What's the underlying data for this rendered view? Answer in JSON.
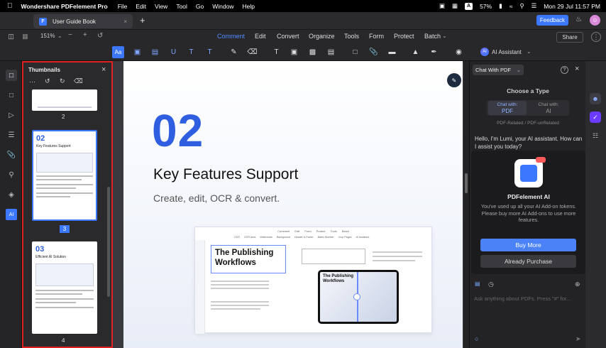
{
  "menubar": {
    "apple": "",
    "app": "Wondershare PDFelement Pro",
    "items": [
      "File",
      "Edit",
      "View",
      "Tool",
      "Go",
      "Window",
      "Help"
    ],
    "battery": "57%",
    "input_badge": "A",
    "datetime": "Mon 29 Jul  11:57 PM"
  },
  "tabbar": {
    "tab_title": "User Guide Book",
    "add_tab": "+",
    "feedback": "Feedback"
  },
  "toolbar": {
    "zoom": "151%",
    "menus": [
      "Comment",
      "Edit",
      "Convert",
      "Organize",
      "Tools",
      "Form",
      "Protect",
      "Batch"
    ],
    "active_menu": "Comment",
    "share": "Share",
    "ai_assistant": "AI Assistant"
  },
  "thumbnails": {
    "title": "Thumbnails",
    "pages": [
      "2",
      "3",
      "4"
    ],
    "current_page": "3",
    "page3_number": "02",
    "page3_title": "Key Features Support",
    "page4_number": "03",
    "page4_title": "Efficient AI Solution"
  },
  "document": {
    "number": "02",
    "heading": "Key Features Support",
    "subheading": "Create, edit, OCR & convert.",
    "embed_menus": [
      "Comment",
      "Edit",
      "Form",
      "Protect",
      "Tools",
      "Batch"
    ],
    "embed_tools": [
      "OCR",
      "OCR Area",
      "Watermark",
      "Background",
      "Header & Footer",
      "Bates Number",
      "Crop Pages",
      "AI Assistant"
    ],
    "embed_title": "The Publishing Workflows",
    "embed_tablet_title": "The Publishing Workflows"
  },
  "ai_panel": {
    "mode_select": "Chat With PDF",
    "choose_type": "Choose a Type",
    "chat_pdf_label1": "Chat with:",
    "chat_pdf_label2": "PDF",
    "chat_ai_label1": "Chat with:",
    "chat_ai_label2": "AI",
    "related": "PDF-Related / PDF-unRelated",
    "greeting": "Hello, I'm Lumi, your AI assistant. How can I assist you today?",
    "promo_title": "PDFelement AI",
    "promo_text": "You've used up all your AI Add-on tokens. Please buy more AI Add-ons to use more features.",
    "buy_more": "Buy More",
    "already_purchase": "Already Purchase",
    "input_placeholder": "Ask anything about PDFs. Press \"#\" for..."
  }
}
